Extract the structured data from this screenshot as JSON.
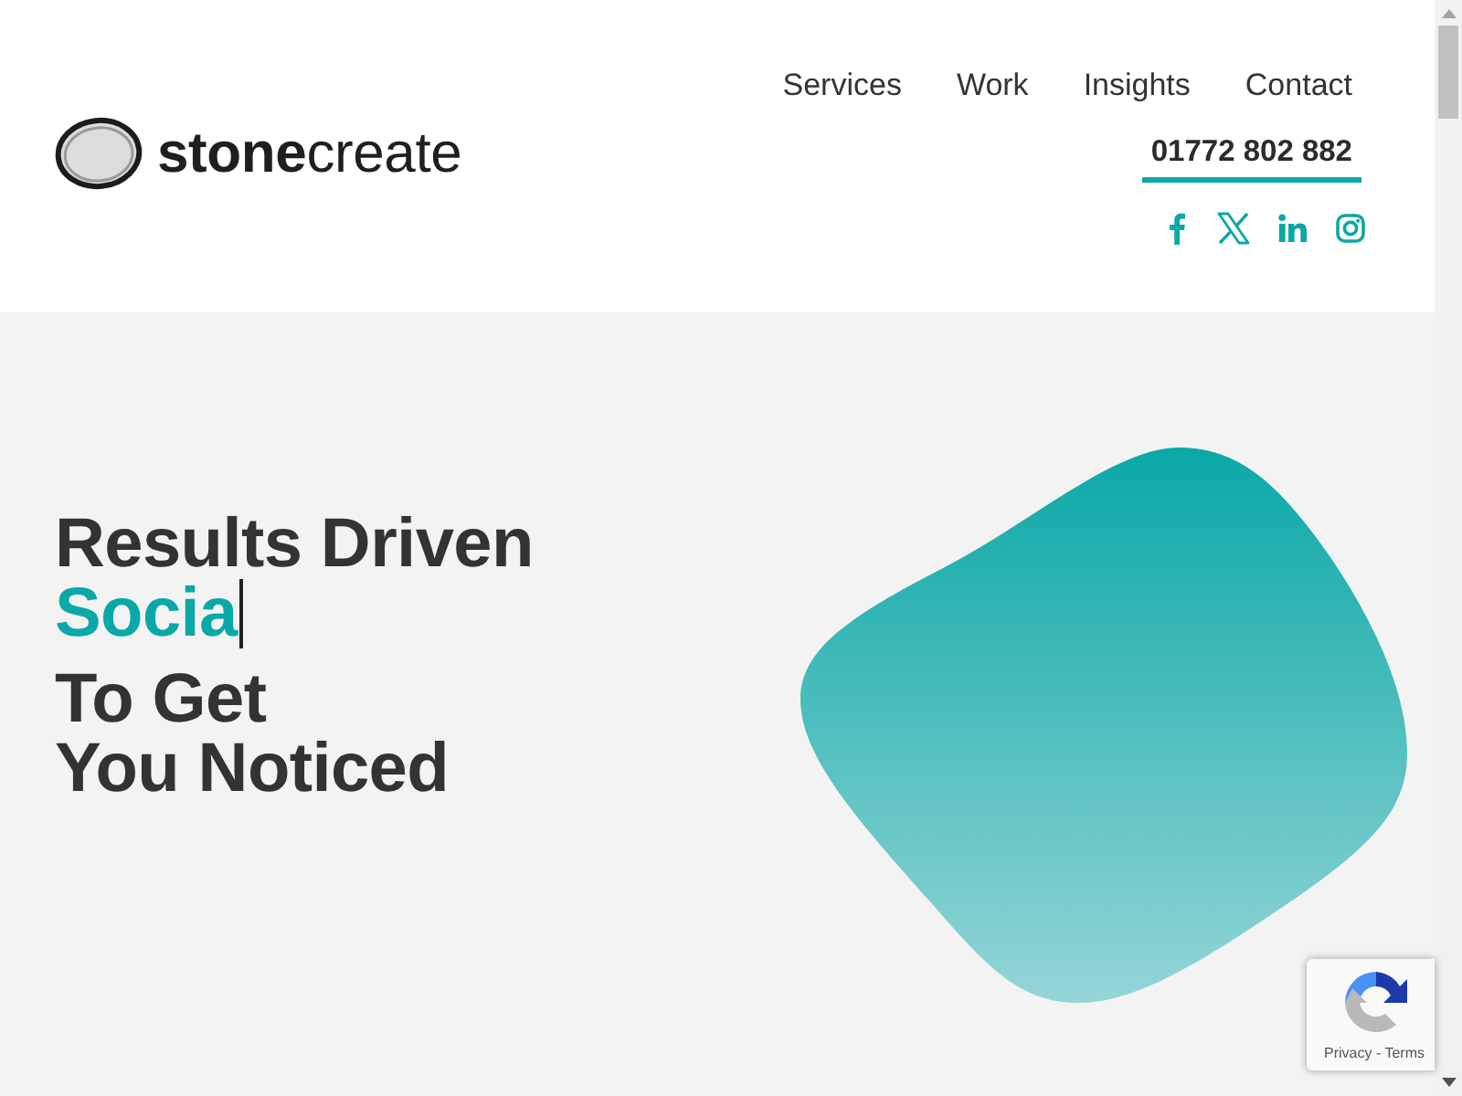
{
  "header": {
    "logo": {
      "text": "**stone**create"
    },
    "nav": [
      {
        "label": "Services"
      },
      {
        "label": "Work"
      },
      {
        "label": "Insights"
      },
      {
        "label": "Contact"
      }
    ],
    "phone": "01772 802 882",
    "social": [
      {
        "kind": "facebook"
      },
      {
        "kind": "x"
      },
      {
        "kind": "linkedin"
      },
      {
        "kind": "instagram"
      }
    ]
  },
  "hero": {
    "headline": [
      {
        "text": "Results Driven",
        "accent": false,
        "cursor": false
      },
      {
        "text": "Socia",
        "accent": true,
        "cursor": true
      },
      {
        "text": "To Get",
        "accent": false,
        "cursor": false
      },
      {
        "text": "You Noticed",
        "accent": false,
        "cursor": false
      }
    ]
  },
  "recaptcha": {
    "links": "Privacy - Terms"
  }
}
